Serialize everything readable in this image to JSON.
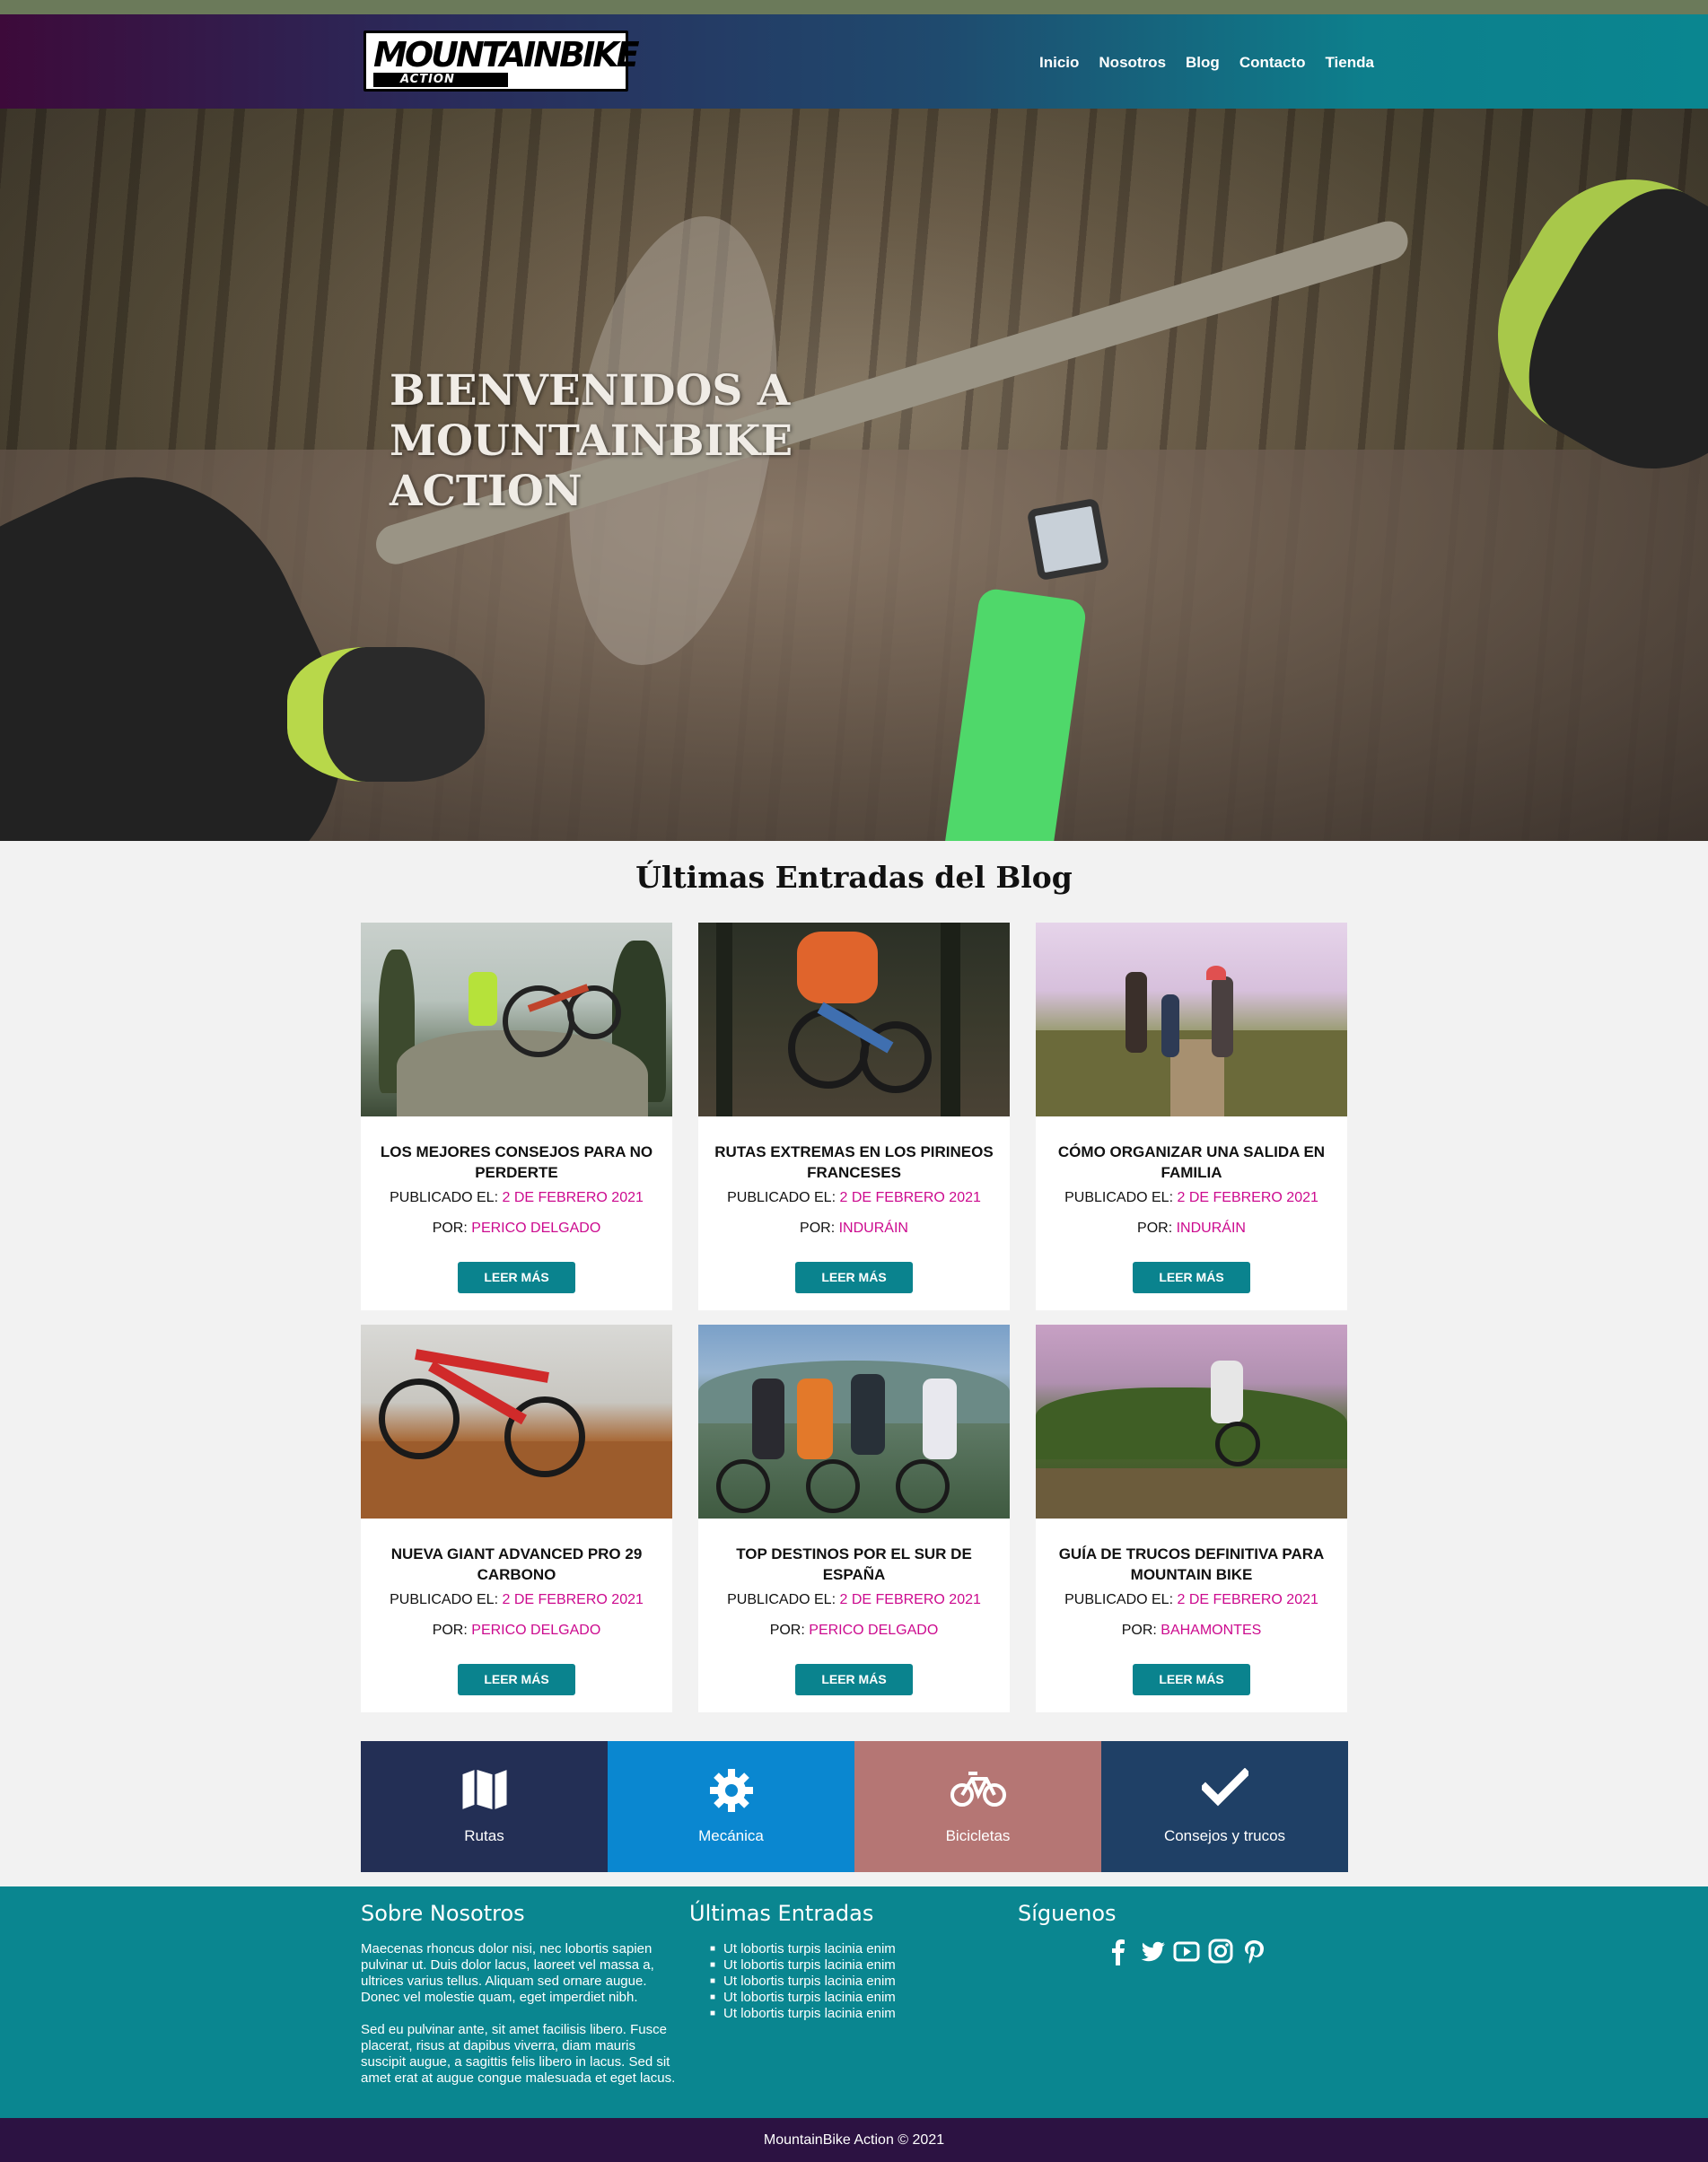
{
  "header": {
    "logo_text_main": "MOUNTAINBIKE",
    "logo_text_sub": "ACTION",
    "nav": [
      "Inicio",
      "Nosotros",
      "Blog",
      "Contacto",
      "Tienda"
    ]
  },
  "hero": {
    "title": "BIENVENIDOS A MOUNTAINBIKE ACTION"
  },
  "blog": {
    "heading": "Últimas Entradas del Blog",
    "published_label": "PUBLICADO EL:",
    "by_label": "POR:",
    "button_label": "LEER MÁS",
    "posts": [
      {
        "title": "LOS MEJORES CONSEJOS PARA NO PERDERTE",
        "date": "2 DE FEBRERO 2021",
        "author": "PERICO DELGADO"
      },
      {
        "title": "RUTAS EXTREMAS EN LOS PIRINEOS FRANCESES",
        "date": "2 DE FEBRERO 2021",
        "author": "INDURÁIN"
      },
      {
        "title": "CÓMO ORGANIZAR UNA SALIDA EN FAMILIA",
        "date": "2 DE FEBRERO 2021",
        "author": "INDURÁIN"
      },
      {
        "title": "NUEVA GIANT ADVANCED PRO 29 CARBONO",
        "date": "2 DE FEBRERO 2021",
        "author": "PERICO DELGADO"
      },
      {
        "title": "TOP DESTINOS POR EL SUR DE ESPAÑA",
        "date": "2 DE FEBRERO 2021",
        "author": "PERICO DELGADO"
      },
      {
        "title": "GUÍA DE TRUCOS DEFINITIVA PARA MOUNTAIN BIKE",
        "date": "2 DE FEBRERO 2021",
        "author": "BAHAMONTES"
      }
    ]
  },
  "categories": [
    {
      "label": "Rutas",
      "icon": "map-icon",
      "color": "#232f55"
    },
    {
      "label": "Mecánica",
      "icon": "gear-icon",
      "color": "#0a87d0"
    },
    {
      "label": "Bicicletas",
      "icon": "bicycle-icon",
      "color": "#b57674"
    },
    {
      "label": "Consejos y trucos",
      "icon": "check-icon",
      "color": "#1f4066"
    }
  ],
  "footer": {
    "about_title": "Sobre Nosotros",
    "about_p1": "Maecenas rhoncus dolor nisi, nec lobortis sapien pulvinar ut. Duis dolor lacus, laoreet vel massa a, ultrices varius tellus. Aliquam sed ornare augue. Donec vel molestie quam, eget imperdiet nibh.",
    "about_p2": "Sed eu pulvinar ante, sit amet facilisis libero. Fusce placerat, risus at dapibus viverra, diam mauris suscipit augue, a sagittis felis libero in lacus. Sed sit amet erat at augue congue malesuada et eget lacus.",
    "latest_title": "Últimas Entradas",
    "latest_items": [
      "Ut lobortis turpis lacinia enim",
      "Ut lobortis turpis lacinia enim",
      "Ut lobortis turpis lacinia enim",
      "Ut lobortis turpis lacinia enim",
      "Ut lobortis turpis lacinia enim"
    ],
    "follow_title": "Síguenos",
    "social_icons": [
      "facebook-icon",
      "twitter-icon",
      "youtube-icon",
      "instagram-icon",
      "pinterest-icon"
    ],
    "copyright": "MountainBike Action © 2021"
  },
  "colors": {
    "accent": "#0a838e",
    "highlight": "#cc0a8e",
    "footer_bg": "#0a8690",
    "copyright_bg": "#2c1242"
  }
}
